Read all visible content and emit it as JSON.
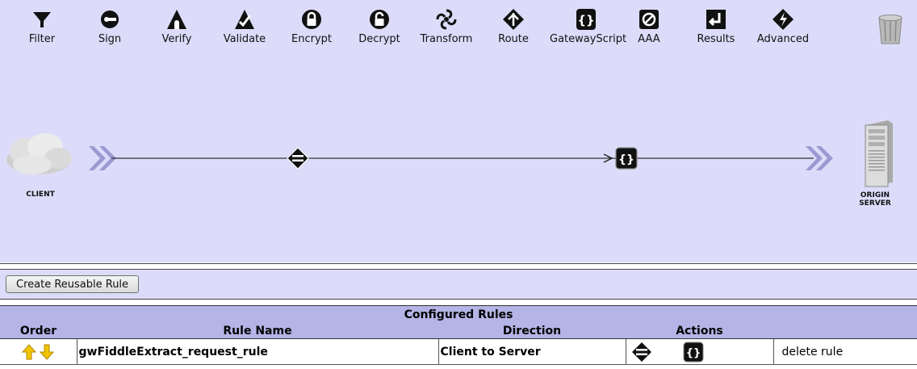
{
  "toolbar": {
    "items": [
      {
        "label": "Filter"
      },
      {
        "label": "Sign"
      },
      {
        "label": "Verify"
      },
      {
        "label": "Validate"
      },
      {
        "label": "Encrypt"
      },
      {
        "label": "Decrypt"
      },
      {
        "label": "Transform"
      },
      {
        "label": "Route"
      },
      {
        "label": "GatewayScript"
      },
      {
        "label": "AAA"
      },
      {
        "label": "Results"
      },
      {
        "label": "Advanced"
      }
    ],
    "trash_icon": "trash-can-icon"
  },
  "flow": {
    "client_label": "CLIENT",
    "server_label_line1": "ORIGIN",
    "server_label_line2": "SERVER",
    "actions": [
      "match-icon",
      "gatewayscript-icon"
    ]
  },
  "actions_bar": {
    "create_rule_label": "Create Reusable Rule"
  },
  "rules_table": {
    "caption": "Configured Rules",
    "headers": {
      "order": "Order",
      "rule_name": "Rule Name",
      "direction": "Direction",
      "actions": "Actions"
    },
    "rows": [
      {
        "rule_name": "gwFiddleExtract_request_rule",
        "direction": "Client to Server",
        "delete_label": "delete rule"
      }
    ]
  },
  "colors": {
    "canvas_bg": "#dcdcfa",
    "header_bg": "#b4b4e6",
    "arrow_yellow": "#f2c400"
  }
}
